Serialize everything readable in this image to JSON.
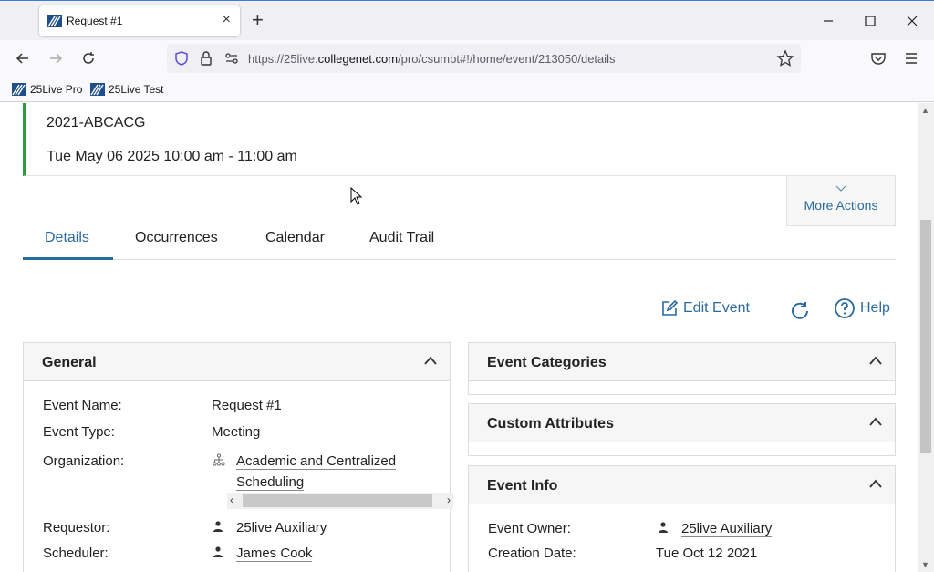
{
  "browser": {
    "tab_title": "Request #1",
    "tab_close": "×",
    "new_tab": "+",
    "url_prefix": "https://25live.",
    "url_host": "collegenet.com",
    "url_path": "/pro/csumbt#!/home/event/213050/details",
    "bookmarks": [
      "25Live Pro",
      "25Live Test"
    ]
  },
  "event": {
    "code": "2021-ABCACG",
    "datetime": "Tue May 06 2025 10:00 am - 11:00 am"
  },
  "more_actions": "More Actions",
  "tabs": [
    "Details",
    "Occurrences",
    "Calendar",
    "Audit Trail"
  ],
  "actions": {
    "edit": "Edit Event",
    "help": "Help"
  },
  "general": {
    "title": "General",
    "rows": {
      "event_name_label": "Event Name:",
      "event_name": "Request #1",
      "event_type_label": "Event Type:",
      "event_type": "Meeting",
      "organization_label": "Organization:",
      "organization_line1": "Academic and Centralized",
      "organization_line2": "Scheduling",
      "requestor_label": "Requestor:",
      "requestor": "25live Auxiliary",
      "scheduler_label": "Scheduler:",
      "scheduler": "James Cook"
    }
  },
  "event_categories": {
    "title": "Event Categories"
  },
  "custom_attributes": {
    "title": "Custom Attributes"
  },
  "event_info": {
    "title": "Event Info",
    "owner_label": "Event Owner:",
    "owner": "25live Auxiliary",
    "creation_label": "Creation Date:",
    "creation": "Tue Oct 12 2021"
  },
  "colors": {
    "accent": "#2b6a9e",
    "status_bar": "#2e9a3e"
  }
}
